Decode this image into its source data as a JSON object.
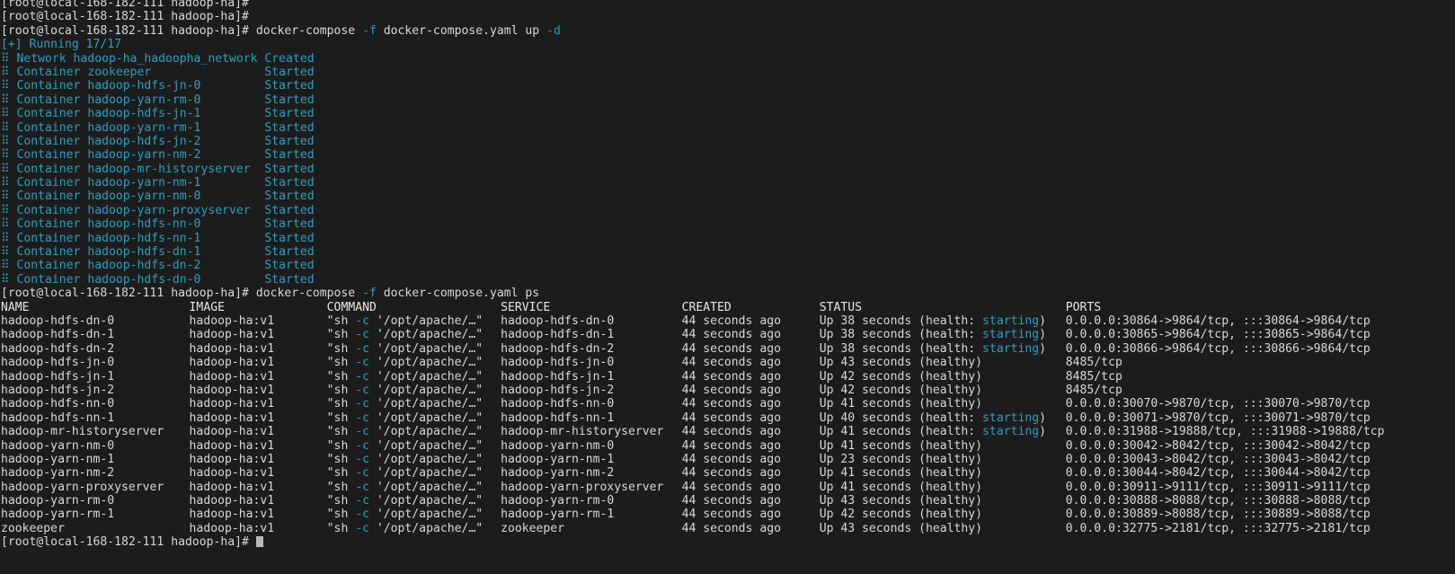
{
  "terminal": {
    "background": "#1c1c1c",
    "foreground": "#d8d8d8",
    "accent_cyan": "#2e9fc0",
    "prompt": "[root@local-168-182-111 hadoop-ha]#",
    "hostname": "local-168-182-111",
    "user": "root",
    "cwd": "hadoop-ha",
    "cursor": "block-cursor"
  },
  "commands": {
    "up": {
      "program": "docker-compose",
      "flag_f": "-f",
      "file": "docker-compose.yaml",
      "action": "up",
      "flag_d": "-d",
      "full": "docker-compose -f docker-compose.yaml up -d"
    },
    "ps": {
      "program": "docker-compose",
      "flag_f": "-f",
      "file": "docker-compose.yaml",
      "action": "ps",
      "full": "docker-compose -f docker-compose.yaml ps"
    }
  },
  "running": {
    "header": "[+] Running 17/17",
    "bullet": "⠿",
    "resources": [
      {
        "kind": "Network",
        "name": "hadoop-ha_hadoopha_network",
        "state": "Created"
      },
      {
        "kind": "Container",
        "name": "zookeeper",
        "state": "Started"
      },
      {
        "kind": "Container",
        "name": "hadoop-hdfs-jn-0",
        "state": "Started"
      },
      {
        "kind": "Container",
        "name": "hadoop-yarn-rm-0",
        "state": "Started"
      },
      {
        "kind": "Container",
        "name": "hadoop-hdfs-jn-1",
        "state": "Started"
      },
      {
        "kind": "Container",
        "name": "hadoop-yarn-rm-1",
        "state": "Started"
      },
      {
        "kind": "Container",
        "name": "hadoop-hdfs-jn-2",
        "state": "Started"
      },
      {
        "kind": "Container",
        "name": "hadoop-yarn-nm-2",
        "state": "Started"
      },
      {
        "kind": "Container",
        "name": "hadoop-mr-historyserver",
        "state": "Started"
      },
      {
        "kind": "Container",
        "name": "hadoop-yarn-nm-1",
        "state": "Started"
      },
      {
        "kind": "Container",
        "name": "hadoop-yarn-nm-0",
        "state": "Started"
      },
      {
        "kind": "Container",
        "name": "hadoop-yarn-proxyserver",
        "state": "Started"
      },
      {
        "kind": "Container",
        "name": "hadoop-hdfs-nn-0",
        "state": "Started"
      },
      {
        "kind": "Container",
        "name": "hadoop-hdfs-nn-1",
        "state": "Started"
      },
      {
        "kind": "Container",
        "name": "hadoop-hdfs-dn-1",
        "state": "Started"
      },
      {
        "kind": "Container",
        "name": "hadoop-hdfs-dn-2",
        "state": "Started"
      },
      {
        "kind": "Container",
        "name": "hadoop-hdfs-dn-0",
        "state": "Started"
      }
    ]
  },
  "ps_table": {
    "columns": [
      "NAME",
      "IMAGE",
      "COMMAND",
      "SERVICE",
      "CREATED",
      "STATUS",
      "PORTS"
    ],
    "command_prefix": "\"sh ",
    "command_flag": "-c",
    "command_suffix": " '/opt/apache/…\"",
    "rows": [
      {
        "name": "hadoop-hdfs-dn-0",
        "image": "hadoop-ha:v1",
        "service": "hadoop-hdfs-dn-0",
        "created": "44 seconds ago",
        "status_main": "Up 38 seconds (health: ",
        "status_health": "starting",
        "status_tail": ")",
        "ports": "0.0.0.0:30864->9864/tcp, :::30864->9864/tcp"
      },
      {
        "name": "hadoop-hdfs-dn-1",
        "image": "hadoop-ha:v1",
        "service": "hadoop-hdfs-dn-1",
        "created": "44 seconds ago",
        "status_main": "Up 38 seconds (health: ",
        "status_health": "starting",
        "status_tail": ")",
        "ports": "0.0.0.0:30865->9864/tcp, :::30865->9864/tcp"
      },
      {
        "name": "hadoop-hdfs-dn-2",
        "image": "hadoop-ha:v1",
        "service": "hadoop-hdfs-dn-2",
        "created": "44 seconds ago",
        "status_main": "Up 38 seconds (health: ",
        "status_health": "starting",
        "status_tail": ")",
        "ports": "0.0.0.0:30866->9864/tcp, :::30866->9864/tcp"
      },
      {
        "name": "hadoop-hdfs-jn-0",
        "image": "hadoop-ha:v1",
        "service": "hadoop-hdfs-jn-0",
        "created": "44 seconds ago",
        "status_main": "Up 43 seconds (healthy)",
        "status_health": "",
        "status_tail": "",
        "ports": "8485/tcp"
      },
      {
        "name": "hadoop-hdfs-jn-1",
        "image": "hadoop-ha:v1",
        "service": "hadoop-hdfs-jn-1",
        "created": "44 seconds ago",
        "status_main": "Up 42 seconds (healthy)",
        "status_health": "",
        "status_tail": "",
        "ports": "8485/tcp"
      },
      {
        "name": "hadoop-hdfs-jn-2",
        "image": "hadoop-ha:v1",
        "service": "hadoop-hdfs-jn-2",
        "created": "44 seconds ago",
        "status_main": "Up 42 seconds (healthy)",
        "status_health": "",
        "status_tail": "",
        "ports": "8485/tcp"
      },
      {
        "name": "hadoop-hdfs-nn-0",
        "image": "hadoop-ha:v1",
        "service": "hadoop-hdfs-nn-0",
        "created": "44 seconds ago",
        "status_main": "Up 41 seconds (healthy)",
        "status_health": "",
        "status_tail": "",
        "ports": "0.0.0.0:30070->9870/tcp, :::30070->9870/tcp"
      },
      {
        "name": "hadoop-hdfs-nn-1",
        "image": "hadoop-ha:v1",
        "service": "hadoop-hdfs-nn-1",
        "created": "44 seconds ago",
        "status_main": "Up 40 seconds (health: ",
        "status_health": "starting",
        "status_tail": ")",
        "ports": "0.0.0.0:30071->9870/tcp, :::30071->9870/tcp"
      },
      {
        "name": "hadoop-mr-historyserver",
        "image": "hadoop-ha:v1",
        "service": "hadoop-mr-historyserver",
        "created": "44 seconds ago",
        "status_main": "Up 41 seconds (health: ",
        "status_health": "starting",
        "status_tail": ")",
        "ports": "0.0.0.0:31988->19888/tcp, :::31988->19888/tcp"
      },
      {
        "name": "hadoop-yarn-nm-0",
        "image": "hadoop-ha:v1",
        "service": "hadoop-yarn-nm-0",
        "created": "44 seconds ago",
        "status_main": "Up 41 seconds (healthy)",
        "status_health": "",
        "status_tail": "",
        "ports": "0.0.0.0:30042->8042/tcp, :::30042->8042/tcp"
      },
      {
        "name": "hadoop-yarn-nm-1",
        "image": "hadoop-ha:v1",
        "service": "hadoop-yarn-nm-1",
        "created": "44 seconds ago",
        "status_main": "Up 23 seconds (healthy)",
        "status_health": "",
        "status_tail": "",
        "ports": "0.0.0.0:30043->8042/tcp, :::30043->8042/tcp"
      },
      {
        "name": "hadoop-yarn-nm-2",
        "image": "hadoop-ha:v1",
        "service": "hadoop-yarn-nm-2",
        "created": "44 seconds ago",
        "status_main": "Up 41 seconds (healthy)",
        "status_health": "",
        "status_tail": "",
        "ports": "0.0.0.0:30044->8042/tcp, :::30044->8042/tcp"
      },
      {
        "name": "hadoop-yarn-proxyserver",
        "image": "hadoop-ha:v1",
        "service": "hadoop-yarn-proxyserver",
        "created": "44 seconds ago",
        "status_main": "Up 41 seconds (healthy)",
        "status_health": "",
        "status_tail": "",
        "ports": "0.0.0.0:30911->9111/tcp, :::30911->9111/tcp"
      },
      {
        "name": "hadoop-yarn-rm-0",
        "image": "hadoop-ha:v1",
        "service": "hadoop-yarn-rm-0",
        "created": "44 seconds ago",
        "status_main": "Up 43 seconds (healthy)",
        "status_health": "",
        "status_tail": "",
        "ports": "0.0.0.0:30888->8088/tcp, :::30888->8088/tcp"
      },
      {
        "name": "hadoop-yarn-rm-1",
        "image": "hadoop-ha:v1",
        "service": "hadoop-yarn-rm-1",
        "created": "44 seconds ago",
        "status_main": "Up 42 seconds (healthy)",
        "status_health": "",
        "status_tail": "",
        "ports": "0.0.0.0:30889->8088/tcp, :::30889->8088/tcp"
      },
      {
        "name": "zookeeper",
        "image": "hadoop-ha:v1",
        "service": "zookeeper",
        "created": "44 seconds ago",
        "status_main": "Up 43 seconds (healthy)",
        "status_health": "",
        "status_tail": "",
        "ports": "0.0.0.0:32775->2181/tcp, :::32775->2181/tcp"
      }
    ]
  }
}
